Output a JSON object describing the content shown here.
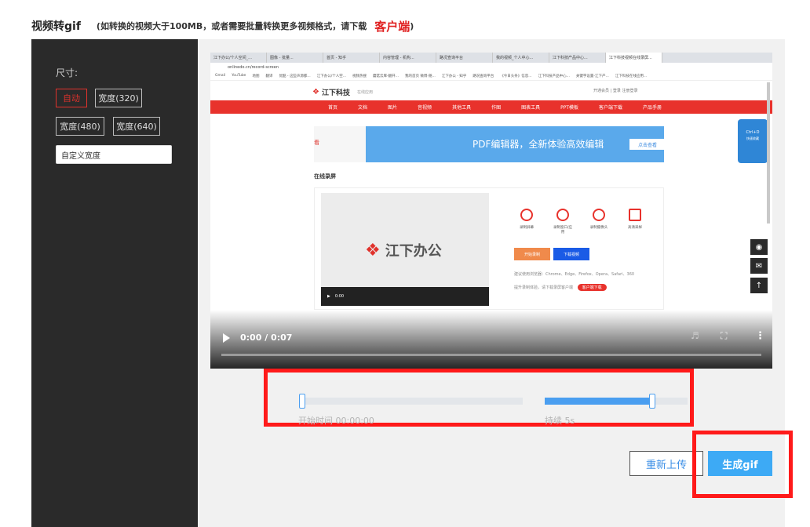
{
  "header": {
    "title": "视频转gif",
    "note": "(如转换的视频大于100MB，或者需要批量转换更多视频格式，请下载",
    "client_link": "客户端",
    "note_close": ")"
  },
  "sidebar": {
    "size_label": "尺寸:",
    "options": [
      "自动",
      "宽度(320)",
      "宽度(480)",
      "宽度(640)"
    ],
    "active_option": "自动",
    "custom_width_value": "自定义宽度"
  },
  "video": {
    "time_display": "0:00 / 0:07",
    "progress_fraction": 0,
    "browser": {
      "tabs": [
        "江下办公/个人空间_...",
        "图像 - 批量...",
        "首页 - 知乎",
        "内容管理 - 机构...",
        "路况查询平台",
        "我的视频_个人中心...",
        "江下科技产品中心...",
        "江下科技视频在线录屏..."
      ],
      "active_tab": 7,
      "url": "onlinedo.cn/record-screen",
      "bookmarks": [
        "Gmail",
        "YouTube",
        "地图",
        "翻译",
        "优酷 - 这些声源都...",
        "江下办公/个人空...",
        "视频热搜",
        "蘑菇云库-翻开...",
        "我的首页 微博-随...",
        "江下办公 - 知乎",
        "路况查询平台",
        "《今日头条》信息...",
        "江下科技产品中心...",
        "关键字设置-江下产...",
        "江下科技在线应用..."
      ]
    },
    "site": {
      "logo": "江下科技",
      "tagline": "在线应用",
      "login": "开通会员  |  登录  注册登录",
      "nav": [
        "首页",
        "文档",
        "图片",
        "音视频",
        "其他工具",
        "作图",
        "图表工具",
        "PPT模板",
        "客户端下载",
        "产品手册"
      ],
      "banner_left": "看",
      "banner_text": "PDF编辑器，全新体验高效编辑",
      "banner_button": "点击查看",
      "section_title": "在线录屏",
      "inner_logo": "江下办公",
      "inner_time": "0:00",
      "features": [
        "录制屏幕",
        "录制窗口/应用",
        "录制摄像头",
        "高清采样"
      ],
      "start_button": "开始录制",
      "download_button": "下载视频",
      "browser_note": "建议使用浏览器：Chrome、Edge、Firefox、Opera、Safari、360",
      "client_note": "提升录制体验，请下载录屏客户端",
      "client_pill": "客户端下载",
      "side_shortcut": "Ctrl+D",
      "side_shortcut_label": "快速收藏"
    }
  },
  "trim": {
    "start_label": "开始时间 00:00:00",
    "duration_label": "持续 5s",
    "start_value": 0,
    "duration_fraction": 0.73
  },
  "actions": {
    "reupload": "重新上传",
    "generate": "生成gif"
  },
  "colors": {
    "accent_red": "#e0322c",
    "button_blue": "#3daaf5",
    "slider_blue": "#4a9ef0",
    "highlight_red": "#ff1a1a"
  }
}
